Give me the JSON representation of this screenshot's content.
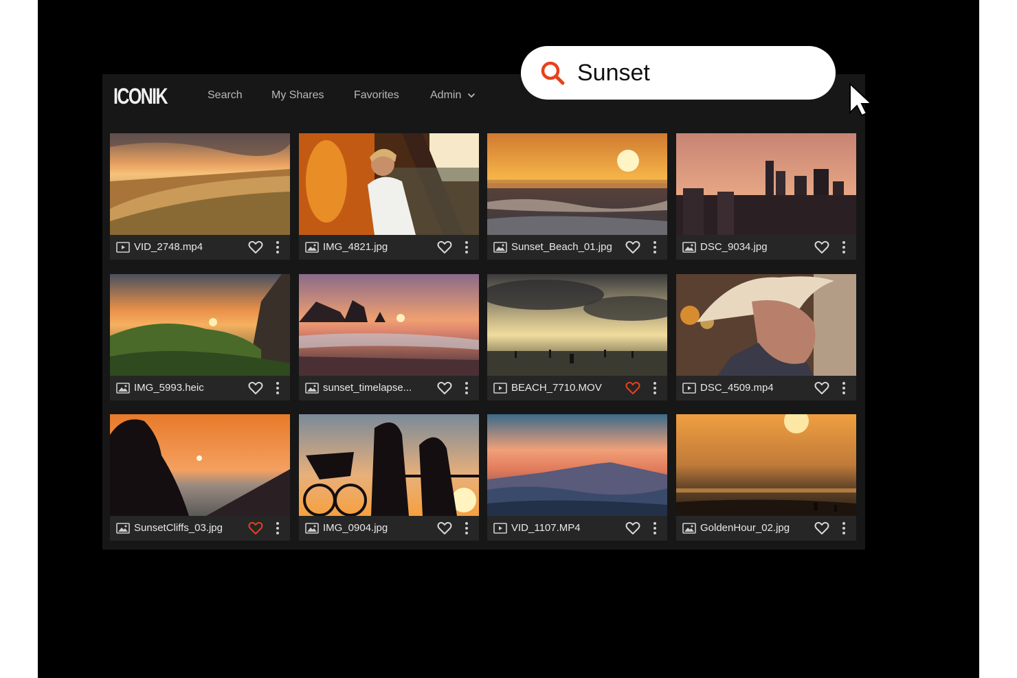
{
  "app": {
    "logo": "ICONIK"
  },
  "nav": {
    "search": "Search",
    "my_shares": "My Shares",
    "favorites": "Favorites",
    "admin": "Admin"
  },
  "search": {
    "value": "Sunset"
  },
  "colors": {
    "accent": "#e8411b",
    "card_bg": "#262626",
    "app_bg": "#171717"
  },
  "assets": [
    {
      "name": "VID_2748.mp4",
      "type": "video",
      "favorite": false,
      "scene": "dunes"
    },
    {
      "name": "IMG_4821.jpg",
      "type": "image",
      "favorite": false,
      "scene": "portrait-bridge"
    },
    {
      "name": "Sunset_Beach_01.jpg",
      "type": "image",
      "favorite": false,
      "scene": "ocean-sun"
    },
    {
      "name": "DSC_9034.jpg",
      "type": "image",
      "favorite": false,
      "scene": "city"
    },
    {
      "name": "IMG_5993.heic",
      "type": "image",
      "favorite": false,
      "scene": "cliffs"
    },
    {
      "name": "sunset_timelapse...",
      "type": "image",
      "favorite": false,
      "scene": "rocks-beach"
    },
    {
      "name": "BEACH_7710.MOV",
      "type": "video",
      "favorite": true,
      "scene": "cloudy-beach"
    },
    {
      "name": "DSC_4509.mp4",
      "type": "video",
      "favorite": false,
      "scene": "cowboy"
    },
    {
      "name": "SunsetCliffs_03.jpg",
      "type": "image",
      "favorite": true,
      "scene": "silhouette"
    },
    {
      "name": "IMG_0904.jpg",
      "type": "image",
      "favorite": false,
      "scene": "bike-couple"
    },
    {
      "name": "VID_1107.MP4",
      "type": "video",
      "favorite": false,
      "scene": "mountains"
    },
    {
      "name": "GoldenHour_02.jpg",
      "type": "image",
      "favorite": false,
      "scene": "golden-sea"
    }
  ]
}
